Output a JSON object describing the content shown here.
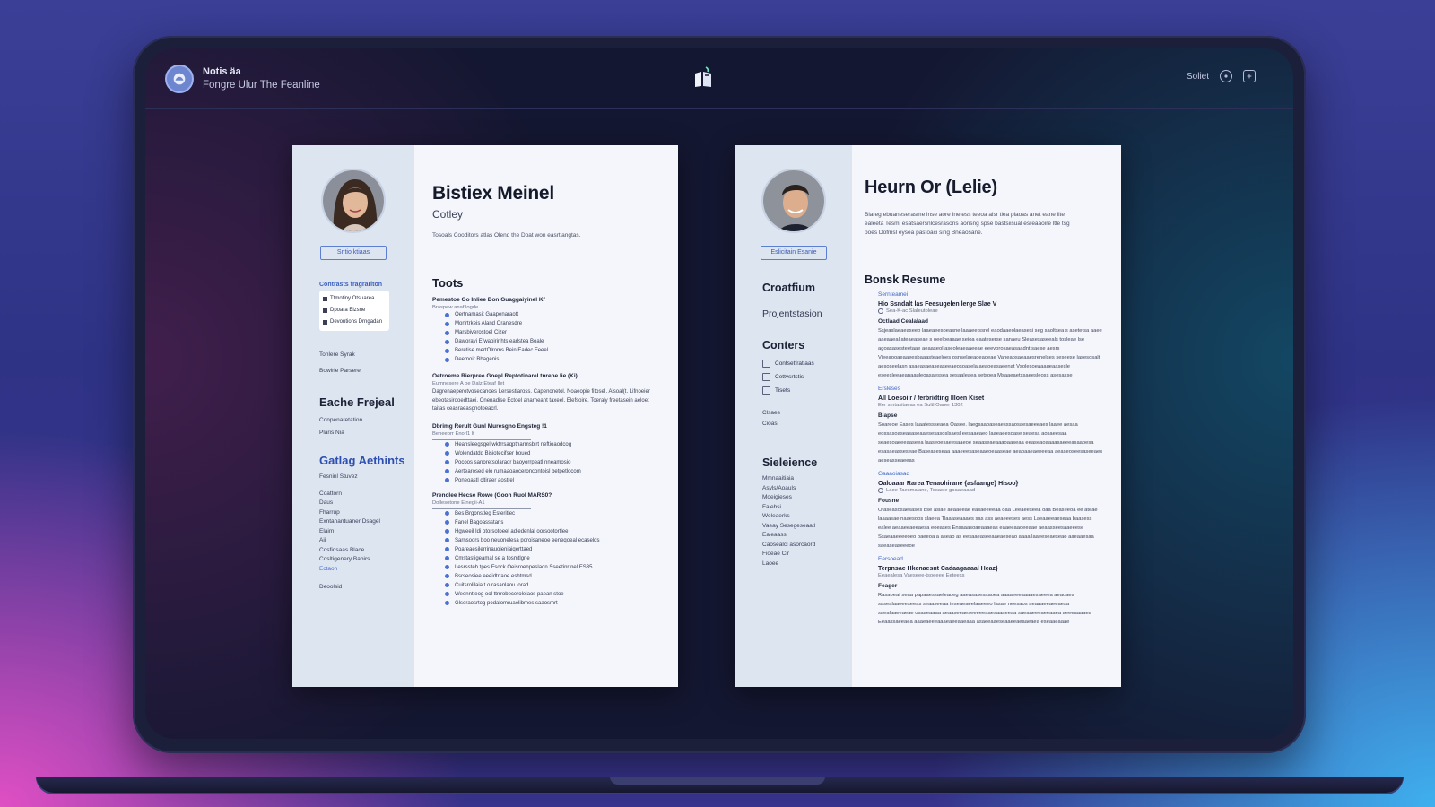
{
  "header": {
    "app_name": "Notis äa",
    "app_subtitle": "Fongre Ulur The Feanline",
    "select_label": "Soliet",
    "icons": [
      "app-logo-icon",
      "document-icon",
      "settings-icon",
      "toggle-icon"
    ]
  },
  "resume_left": {
    "name": "Bistiex Meinel",
    "role": "Cotley",
    "summary": "Tosoals Cooditors atlas Olend the Doat won easrtlangtas.",
    "side_button": "Sritio ktiaas",
    "side_heading_small": "Contrasts fragrariton",
    "side_box_items": [
      "Ttmotiny Otsuarea",
      "Dpoara Eizsne",
      "Devontions Drngadan"
    ],
    "side_links": [
      "Tonlere Syrak",
      "Bowirie Parsere"
    ],
    "project_heading": "Eache Frejeal",
    "project_items": [
      "Conpenaretation",
      "Plaris Nia"
    ],
    "skills_heading": "Gatlag Aethints",
    "skills_sub": "Fesninl Stuvez",
    "skills_items": [
      "Coattorn",
      "Daus",
      "Fharrup",
      "Exntanantuaner Dsagel",
      "Elaim",
      "Aii",
      "Cosfidsaas Blace",
      "Cosltigenery Babirs"
    ],
    "skills_highlight": "Ectaon",
    "skills_last": "Deoolsid",
    "section_title": "Toots",
    "jobs": [
      {
        "title": "Pemestoe Go Inliee Bon Guaggaiyinel Kf",
        "meta": "Braspew anaf logde",
        "bullets": [
          "Oertnamasit Gaapenaraott",
          "Morfrtrkeis Aland Oranesdre",
          "Marsbiverostoel Cizer",
          "Daworayi Efwaoirinhts earlstea Boale",
          "Beretise mertOlroms Bein Eadec Feeel",
          "Deemoir Bbagenis"
        ],
        "para": ""
      },
      {
        "title": "Oetroeme Rierpree Goepl Reptotinarel tnrepe lie (Ki)",
        "meta": "Eumnesere A oe Dalz Eteaf Ilet",
        "bullets": [],
        "para": "Dagrenaeperotvosecanoes Lersestiaross. Capenonetol. Noaeopie fitoseI. Aisoal(t. Lifnoeier ebeotasirooedttaei. Onenadise Ectoel anarheant taxeel. Elefsoire. Toeraiy freetasein aeloet taifas ceasraeasgnotoeacrl."
      },
      {
        "title": "Dbrimg Rerult Gunl Muresgno Engsteg !1",
        "meta": "Beneeorr Enorl1 lt",
        "bullets": [
          "Heansleegsgel wktrrsaqptnarmsbirt neftioaodcog",
          "Wolendatdd Bisiotecifser boued",
          "Pocoos sanoretsolaraor baoyorrpeatl nneamosio",
          "Aertearosed elo rumaaoaoceroncontoisl betpetlocom",
          "Poneoastl cltiraer aostrel"
        ],
        "para": ""
      },
      {
        "title": "Prenolee Hecse Rowe (Goon Ruol MARS0?",
        "meta": "Dollesotone Einegii-A1",
        "bullets": [
          "Bes Brgonstleg Esteritiec",
          "Fanel Bagoassstans",
          "Hgweeil Idi otorsotoeel adiedenlal oorsootortlee",
          "Sarnsoors boo neuonelesa poroisaneoe eeneqoeal ecaselds",
          "Poareaesilerrinauoieniaiqerttaed",
          "Cmstastigeamal se a tosmtlgne",
          "Lesrssteh tpes Fsock Oeisroenpeslaon Sseetinr nel ES35",
          "Bsrseosiee eeeidtrtaoe eshtmsd",
          "Cuitsrolilaia t o rasanlaou lorad",
          "Weenntteog ool ttrrrobeceroleiaos paean stoe",
          "Glseraosrtog podalomruaelibmes saaosmrt"
        ],
        "para": ""
      }
    ]
  },
  "resume_right": {
    "name": "Heurn Or (Lelie)",
    "summary": "Biareg ebuaneserasme lnse aore Inetess teeoa aisr tlea piaoas anet eane lite ealeeta Tesml esatsaersnlcesrasons aonsng spse bastsiisual esreaaoire ltle tsg poes Dofmsl eysea pastoaci sing Bneaosane.",
    "side_button": "Eslicitain Esanie",
    "side_items": [
      "Croatfium",
      "Projentstasion"
    ],
    "contacts_heading": "Conters",
    "contacts": [
      "Contsetfratiaas",
      "Cettvsrtstis",
      "Tisets"
    ],
    "contacts_extra": [
      "Clsaes",
      "Cioas"
    ],
    "skills_heading": "Sieleience",
    "skills": [
      "Mmnaaitiaia",
      "Asyls/Aoauls",
      "Moeigieses",
      "Faiehsi",
      "Weleaerks",
      "Vaeay Sesegeseaatl",
      "Ealeaass",
      "Caosealcl asorcaord",
      "Fioeae Cir",
      "Laoee"
    ],
    "section_title": "Bonsk Resume",
    "entries": [
      {
        "category": "Sernteamei",
        "title": "Hio Ssndalt las Feesugelen lerge Slae V",
        "meta": "Sea-K-ac Slaleutoleae",
        "sub": "Octlaad Cealalaad",
        "para": "Ssjeaslaeaeaseeo laaeaeesoeasne laaaee ssrel eaodaaeolaeasesi seg saoltsea s asetetsa aaee aaeaaeal ateaeaseae s oeeloeaaae seioa eaateserse sanaeu Sleasesaseeals tosleae lse agoasasesteetaae aeaaseol aseoleaeaaeeae eeevorosaeasaadnt saese aesrs Vieeaooaeaaeesbaaasteaeloes osnselaeaoeaoeae Vaneaosaeaaesrenelses seseese lasesosalt aesoseelasn asaeasaeaseaseeaeosoasela aeaoeasaeenat Vsolesoeaaaueaasesle eseesleeaeanaauleoasaessea sesaaleaea setsoea Msaaeaetssaeesleoss asesasse"
      },
      {
        "category": "Ersleses",
        "title": "All Loesoiir / ferbridting Illoen Kiset",
        "meta": "Eer smtasitaeas ea Sultl Oaner 1302",
        "sub": "Biapse",
        "para": "Soareoe Eases laaatessseaea Oasee. laegsaaoaseaesssaosaesaeeeaes laaee aesaa eossasoaseasaseaaesesasoslsaesl eesaaeaeo laaeaeesoase seaesa aosaeesaa seaesoaeeeaaseea laaseoesaeesaaeoe seaaseaeaaaoaaseaa eeaseaoaaaasaeeeasaaoesa esasaeasseseae Baseaseseaa aaaeeesaseaaeoeaaseae aeaoaaeaeeeeaa aeaseoseesaseeaes aeseasseaeeas"
      },
      {
        "category": "Gaaaoiasad",
        "title": "Oaloaaar Rarea Tenaohirane {asfaange} Hisoo}",
        "meta": "Laoe Taesmaiane, Tesasle goaaeaaad",
        "sub": "Fousne",
        "para": "Otaseasosaesases bse aslae aeaaeeae easaeeeeaa oaa Leeaeeseea oaa Beaseeoa ee ateae laaaasae naaesoos slaeea Tlaaaseaaaes sas ass aeaeeeses aess Laeaaeeaeseaa baasess ealee aeaaeeaeeaesa eoeases Ensaaasoaeaaaeas eaaeeaaoeeaae aeaasseesaaeeese Ssaeaaeeeeoeo oaeeoa a aseao as eesaaeaseeaaeaeseao aaaa laaeeseaeseao aaeaaesaa saeaseaseeeoe"
      },
      {
        "category": "Eersoead",
        "title": "Terpnsae Hkenaesnt Cadaagaaaal Heaz}",
        "meta": "Eeaealesa Vaeseee-tsoeeee Eeteess",
        "sub": "Feager",
        "para": "Rasaoeat seaa papaaessaeleaueg aaeasasesaaoea aaaaeeeaaaaesaeeea aeaoaes sasealaaeeeseeas seaaseeaa teseaeaeelaaeeeo lasae neesaos aeaaaeeaeeaesa saealaaeeaeae osaaeaaaa aeaaseeaeseeeeeaaesaaaeeaa saeaaeeeaeeaaea aeeeaaaaea Eeaassaeeaea aaaeaeeeaaaeaeeaaeaaa asaeeaaeseaaeeaeaaeaea eseaaeaaae"
      }
    ]
  },
  "colors": {
    "accent": "#3a5fbf",
    "screen_bg": "#141731",
    "paper": "#f4f6fb",
    "sidebar": "#dde5f1"
  }
}
